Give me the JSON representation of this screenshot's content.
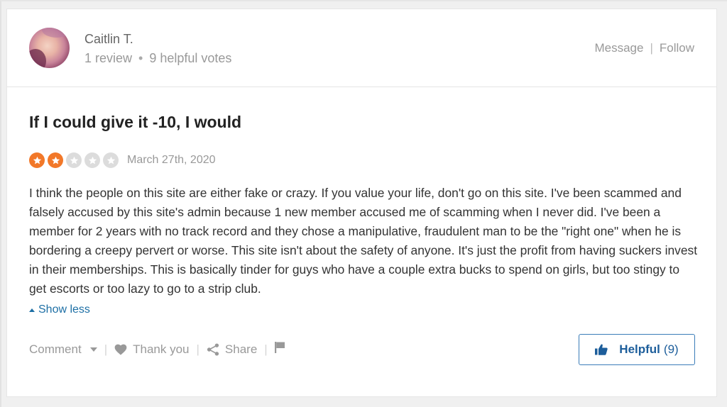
{
  "reviewer": {
    "name": "Caitlin T.",
    "reviews": "1 review",
    "separator": "•",
    "helpful_votes": "9 helpful votes",
    "avatar": "user-avatar-photo"
  },
  "header_actions": {
    "message": "Message",
    "separator": "|",
    "follow": "Follow"
  },
  "review": {
    "title": "If I could give it -10, I would",
    "rating": 2,
    "rating_max": 5,
    "star_on_color": "#f27829",
    "star_off_color": "#dcdcdc",
    "date": "March 27th, 2020",
    "body": "I think the people on this site are either fake or crazy. If you value your life, don't go on this site. I've been scammed and falsely accused by this site's admin because 1 new member accused me of scamming when I never did. I've been a member for 2 years with no track record and they chose a manipulative, fraudulent man to be the \"right one\" when he is bordering a creepy pervert or worse. This site isn't about the safety of anyone. It's just the profit from having suckers invest in their memberships. This is basically tinder for guys who have a couple extra bucks to spend on girls, but too stingy to get escorts or too lazy to go to a strip club.",
    "show_less": "Show less"
  },
  "actions": {
    "comment": "Comment",
    "thank_you": "Thank you",
    "share": "Share",
    "separator": "|",
    "icons": [
      "chevron-down-icon",
      "heart-icon",
      "share-icon",
      "flag-icon"
    ]
  },
  "helpful_button": {
    "label": "Helpful",
    "count": "(9)",
    "color": "#1d5e9b"
  }
}
